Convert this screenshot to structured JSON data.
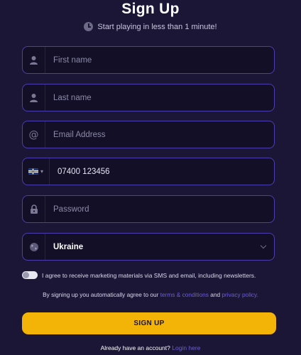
{
  "header": {
    "title": "Sign Up",
    "subtitle": "Start playing in less than 1 minute!"
  },
  "form": {
    "first_name": {
      "placeholder": "First name",
      "icon": "user-icon"
    },
    "last_name": {
      "placeholder": "Last name",
      "icon": "user-icon"
    },
    "email": {
      "placeholder": "Email Address",
      "icon": "at-icon"
    },
    "phone": {
      "value": "07400 123456",
      "country_flag": "uk-flag-icon"
    },
    "password": {
      "placeholder": "Password",
      "icon": "lock-icon"
    },
    "country": {
      "value": "Ukraine",
      "icon": "globe-icon"
    }
  },
  "consent": {
    "label": "I agree to receive marketing materials via SMS and email, including newsletters.",
    "enabled": false
  },
  "terms": {
    "prefix": "By signing up you automatically agree to our",
    "terms_link": "terms & conditions",
    "and": "and",
    "privacy_link": "privacy policy."
  },
  "actions": {
    "signup_label": "SIGN UP"
  },
  "login": {
    "prompt": "Already have an account?",
    "link": "Login here"
  },
  "colors": {
    "background": "#1b1636",
    "field_border": "#4b3fb0",
    "accent_button": "#f3b307",
    "link": "#6a5fd8"
  }
}
